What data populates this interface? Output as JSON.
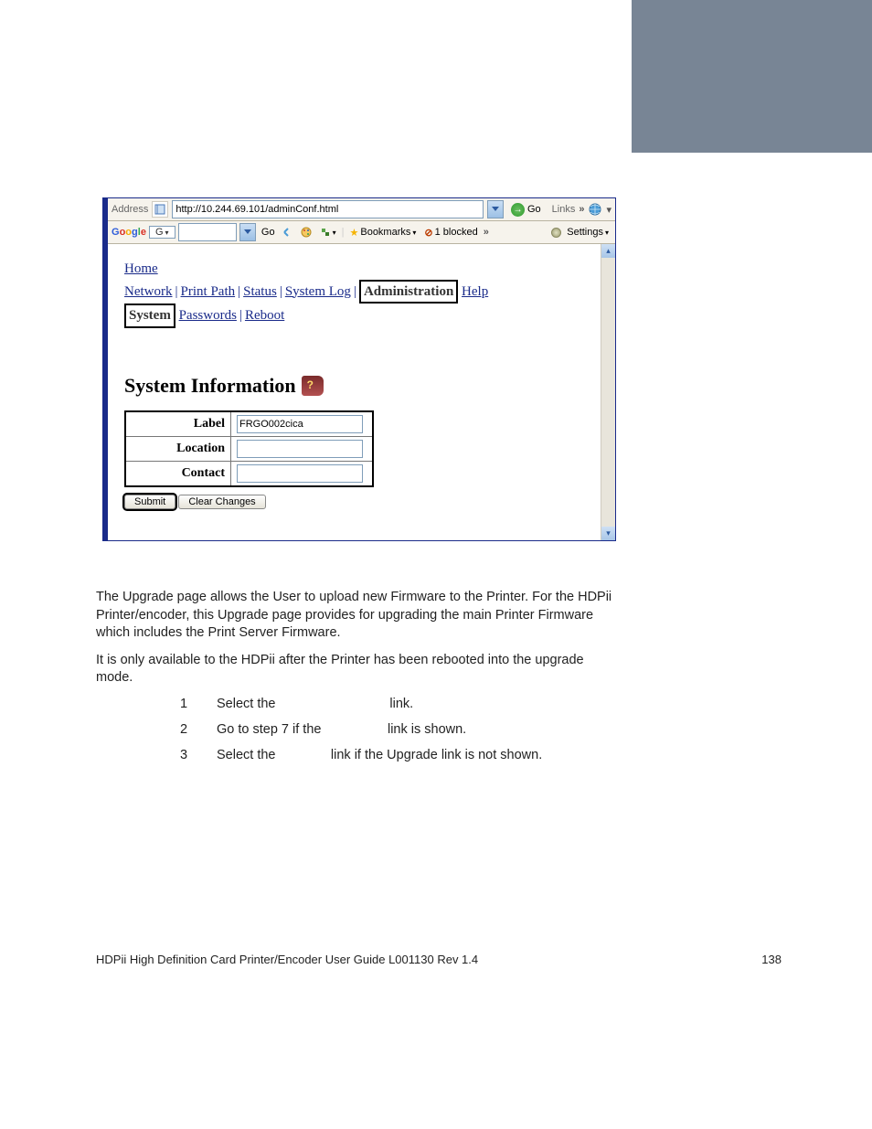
{
  "ie": {
    "address_label": "Address",
    "url": "http://10.244.69.101/adminConf.html",
    "go_label": "Go",
    "links_label": "Links"
  },
  "google": {
    "go": "Go",
    "bookmarks": "Bookmarks",
    "blocked": "1 blocked",
    "settings": "Settings"
  },
  "nav": {
    "home": "Home",
    "network": "Network",
    "print_path": "Print Path",
    "status": "Status",
    "system_log": "System Log",
    "administration": "Administration",
    "help": "Help",
    "system": "System",
    "passwords": "Passwords",
    "reboot": "Reboot"
  },
  "heading": "System Information",
  "form": {
    "label_lbl": "Label",
    "label_val": "FRGO002cica",
    "location_lbl": "Location",
    "location_val": "",
    "contact_lbl": "Contact",
    "contact_val": "",
    "submit": "Submit",
    "clear": "Clear Changes"
  },
  "doc": {
    "p1": "The Upgrade page allows the User to upload new Firmware to the Printer. For the HDPii Printer/encoder, this Upgrade page provides for upgrading the main Printer Firmware which includes the Print Server Firmware.",
    "p2": "It is only available to the HDPii after the Printer has been rebooted into the upgrade mode."
  },
  "steps": [
    {
      "n": "1",
      "t": "Select the                               link."
    },
    {
      "n": "2",
      "t": "Go to step 7 if the                  link is shown."
    },
    {
      "n": "3",
      "t": "Select the               link if the Upgrade link is not shown."
    }
  ],
  "footer": {
    "left": "HDPii High Definition Card Printer/Encoder User Guide    L001130 Rev 1.4",
    "page": "138"
  }
}
